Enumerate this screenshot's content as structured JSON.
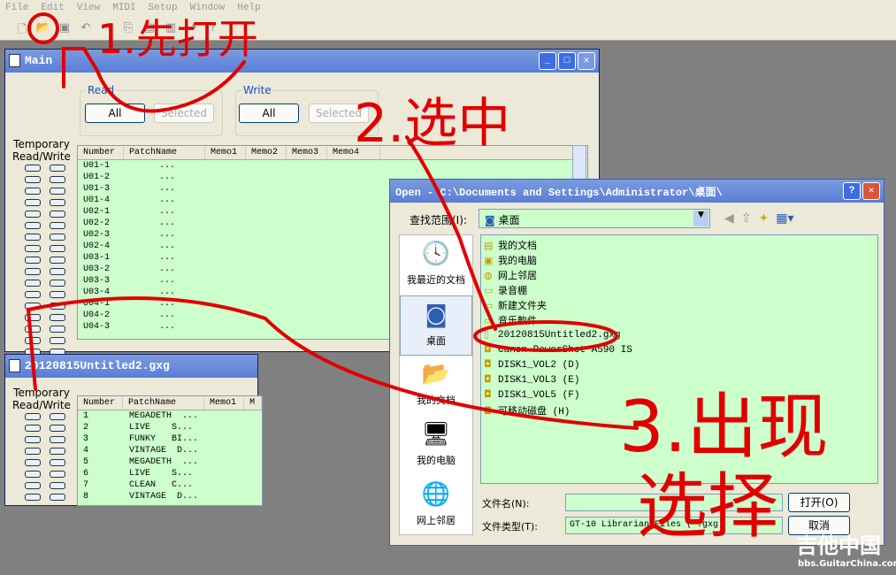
{
  "menu": [
    "File",
    "Edit",
    "View",
    "MIDI",
    "Setup",
    "Window",
    "Help"
  ],
  "toolbar": {
    "icons": [
      "new-icon",
      "open-folder-icon",
      "save-icon",
      "undo-icon",
      "cut-icon",
      "copy-icon",
      "paste-icon",
      "paste2-icon",
      "arrow-icon",
      "help-icon"
    ]
  },
  "main": {
    "title": "Main",
    "read_label": "Read",
    "write_label": "Write",
    "all": "All",
    "selected": "Selected",
    "temp": "Temporary Read/Write",
    "columns": [
      "Number",
      "PatchName",
      "Memo1",
      "Memo2",
      "Memo3",
      "Memo4"
    ],
    "rows": [
      [
        "U01-1",
        "..."
      ],
      [
        "U01-2",
        "..."
      ],
      [
        "U01-3",
        "..."
      ],
      [
        "U01-4",
        "..."
      ],
      [
        "U02-1",
        "..."
      ],
      [
        "U02-2",
        "..."
      ],
      [
        "U02-3",
        "..."
      ],
      [
        "U02-4",
        "..."
      ],
      [
        "U03-1",
        "..."
      ],
      [
        "U03-2",
        "..."
      ],
      [
        "U03-3",
        "..."
      ],
      [
        "U03-4",
        "..."
      ],
      [
        "U04-1",
        "..."
      ],
      [
        "U04-2",
        "..."
      ],
      [
        "U04-3",
        "..."
      ]
    ]
  },
  "file_win": {
    "title": "20120815Untitled2.gxg",
    "temp": "Temporary Read/Write",
    "columns": [
      "Number",
      "PatchName",
      "Memo1",
      "M"
    ],
    "rows": [
      [
        "1",
        "MEGADETH  ..."
      ],
      [
        "2",
        "LIVE    S..."
      ],
      [
        "3",
        "FUNKY   BI..."
      ],
      [
        "4",
        "VINTAGE  D..."
      ],
      [
        "5",
        "MEGADETH  ..."
      ],
      [
        "6",
        "LIVE    S..."
      ],
      [
        "7",
        "CLEAN   C..."
      ],
      [
        "8",
        "VINTAGE  D..."
      ]
    ]
  },
  "dialog": {
    "title": "Open - C:\\Documents and Settings\\Administrator\\桌面\\",
    "lookin_label": "查找范围(I):",
    "lookin_value": "桌面",
    "places": [
      "我最近的文档",
      "桌面",
      "我的文档",
      "我的电脑",
      "网上邻居"
    ],
    "files": [
      "我的文档",
      "我的电脑",
      "网上邻居",
      "录音棚",
      "新建文件夹",
      "音乐軟件",
      "20120815Untitled2.gxg",
      "Canon PowerShot A590 IS",
      "DISK1_VOL2 (D)",
      "DISK1_VOL3 (E)",
      "DISK1_VOL5 (F)",
      "可移动磁盘 (H)"
    ],
    "filename_label": "文件名(N):",
    "filename_value": "",
    "filetype_label": "文件类型(T):",
    "filetype_value": "GT-10 Librarian Files (*.gxg)",
    "open": "打开(O)",
    "cancel": "取消"
  },
  "annotations": {
    "step1": "1.先打开",
    "step2": "2.选中",
    "step3a": "3.出现",
    "step3b": "选择",
    "color": "#e00000"
  },
  "watermark": {
    "text": "吉他中国",
    "url": "bbs.GuitarChina.com"
  }
}
